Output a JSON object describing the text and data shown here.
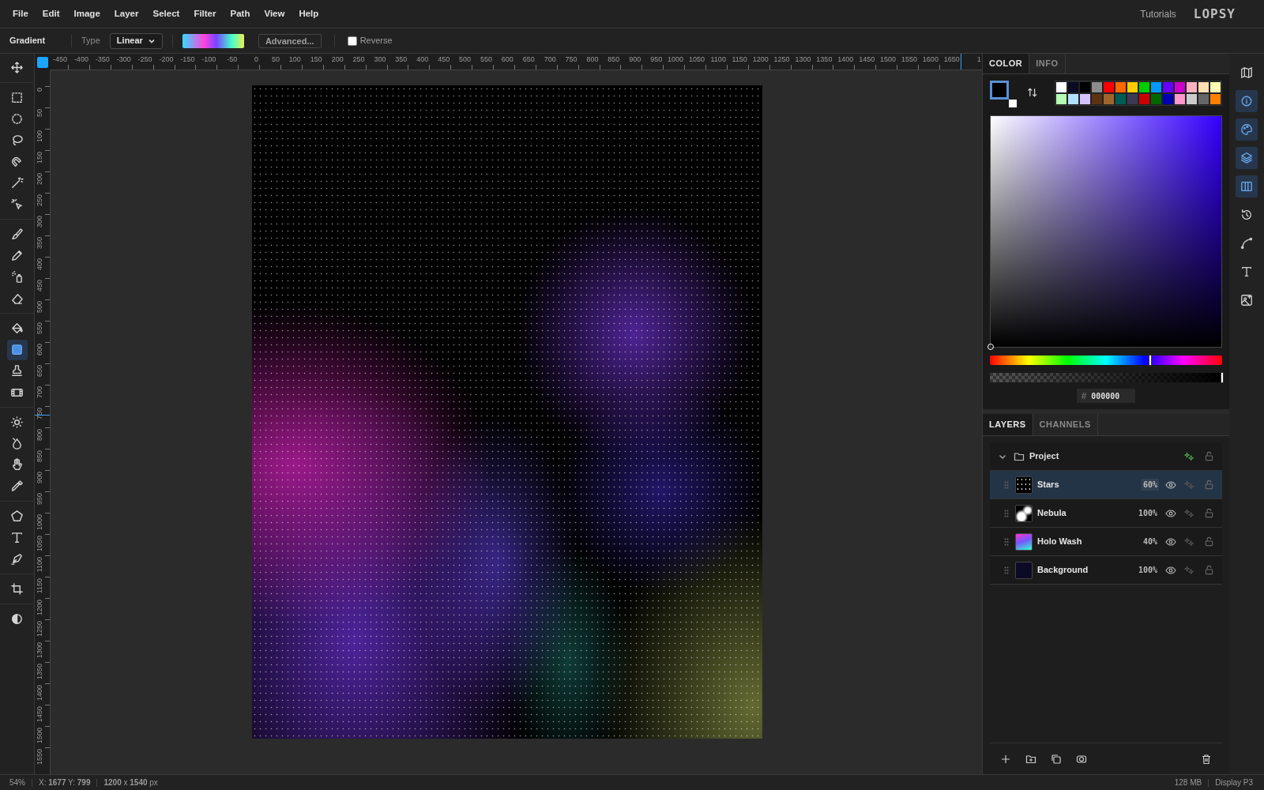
{
  "menu": [
    "File",
    "Edit",
    "Image",
    "Layer",
    "Select",
    "Filter",
    "Path",
    "View",
    "Help"
  ],
  "header": {
    "link": "Tutorials",
    "logo": "LOPSY"
  },
  "options": {
    "tool": "Gradient",
    "type_label": "Type",
    "type_value": "Linear",
    "advanced": "Advanced...",
    "reverse": {
      "label": "Reverse",
      "checked": false
    }
  },
  "tool_groups": [
    [
      {
        "selected": false
      }
    ],
    [
      {
        "selected": false
      },
      {
        "selected": false
      },
      {
        "selected": false
      },
      {
        "selected": false
      },
      {
        "selected": false
      },
      {
        "selected": false
      }
    ],
    [
      {
        "selected": false
      },
      {
        "selected": false
      },
      {
        "selected": false
      },
      {
        "selected": false
      }
    ],
    [
      {
        "selected": false
      },
      {
        "selected": true
      },
      {
        "selected": false
      },
      {
        "selected": false
      }
    ],
    [
      {
        "selected": false
      },
      {
        "selected": false
      },
      {
        "selected": false
      },
      {
        "selected": false
      }
    ],
    [
      {
        "selected": false
      },
      {
        "selected": false
      },
      {
        "selected": false
      }
    ],
    [
      {
        "selected": false
      }
    ],
    [
      {
        "selected": false
      }
    ]
  ],
  "ruler_h": [
    "-450",
    "-400",
    "-350",
    "-300",
    "-250",
    "-200",
    "-150",
    "-100",
    "-50",
    "0",
    "50",
    "100",
    "150",
    "200",
    "250",
    "300",
    "350",
    "400",
    "450",
    "500",
    "550",
    "600",
    "650",
    "700",
    "750",
    "800",
    "850",
    "900",
    "950",
    "1000",
    "1050",
    "1100",
    "1150",
    "1200",
    "1250",
    "1300",
    "1350",
    "1400",
    "1450",
    "1500",
    "1550",
    "1600",
    "1650",
    "1"
  ],
  "ruler_v": [
    "0",
    "50",
    "100",
    "150",
    "200",
    "250",
    "300",
    "350",
    "400",
    "450",
    "500",
    "550",
    "600",
    "650",
    "700",
    "750",
    "800",
    "850",
    "900",
    "950",
    "1000",
    "1050",
    "1100",
    "1150",
    "1200",
    "1250",
    "1300",
    "1350",
    "1400",
    "1450",
    "1500",
    "1550"
  ],
  "color_panel": {
    "tabs": [
      {
        "label": "COLOR",
        "selected": true
      },
      {
        "label": "INFO",
        "selected": false
      }
    ],
    "swatches": [
      {
        "color": "#ffffff"
      },
      {
        "color": "#0a0a23"
      },
      {
        "color": "#000000"
      },
      {
        "color": "#8c8c8c"
      },
      {
        "color": "#ff0000"
      },
      {
        "color": "#ff6600"
      },
      {
        "color": "#ffcc00"
      },
      {
        "color": "#00cc00"
      },
      {
        "color": "#0099ff"
      },
      {
        "color": "#6600ff"
      },
      {
        "color": "#cc00cc"
      },
      {
        "color": "#ffb3c1"
      },
      {
        "color": "#ffe0b3"
      },
      {
        "color": "#ffffb3"
      },
      {
        "color": "#b3ffb3"
      },
      {
        "color": "#b3e0ff"
      },
      {
        "color": "#d4c2ff"
      },
      {
        "color": "#5c3310"
      },
      {
        "color": "#a0652b"
      },
      {
        "color": "#005c55"
      },
      {
        "color": "#3a3a55"
      },
      {
        "color": "#cc0000"
      },
      {
        "color": "#006600"
      },
      {
        "color": "#0000b3"
      },
      {
        "color": "#ff99cc"
      },
      {
        "color": "#cccccc"
      },
      {
        "color": "#666666"
      },
      {
        "color": "#ff8000"
      }
    ],
    "hue": {
      "level": 0.69
    },
    "alpha": {
      "level": 1
    },
    "hex_label": "#",
    "hex": "000000"
  },
  "layers_panel": {
    "tabs": [
      {
        "label": "LAYERS",
        "selected": true
      },
      {
        "label": "CHANNELS",
        "selected": false
      }
    ],
    "group": {
      "name": "Project",
      "expanded": true,
      "effects": true,
      "children": [
        {
          "name": "Stars",
          "opacity": "60%",
          "selected": true
        },
        {
          "name": "Nebula",
          "opacity": "100%",
          "selected": false
        },
        {
          "name": "Holo Wash",
          "opacity": "40%",
          "selected": false
        },
        {
          "name": "Background",
          "opacity": "100%",
          "selected": false
        }
      ]
    }
  },
  "side_strip": [
    {
      "selected": false
    },
    {
      "selected": true
    },
    {
      "selected": true
    },
    {
      "selected": true
    },
    {
      "selected": true
    },
    {
      "selected": false
    },
    {
      "selected": false
    },
    {
      "selected": false
    },
    {
      "selected": false
    }
  ],
  "status": {
    "zoom": "54%",
    "cursor": "X: **1677** Y: **799**",
    "size": "**1200** x **1540** px",
    "memory": "128 MB",
    "profile": "Display P3"
  }
}
